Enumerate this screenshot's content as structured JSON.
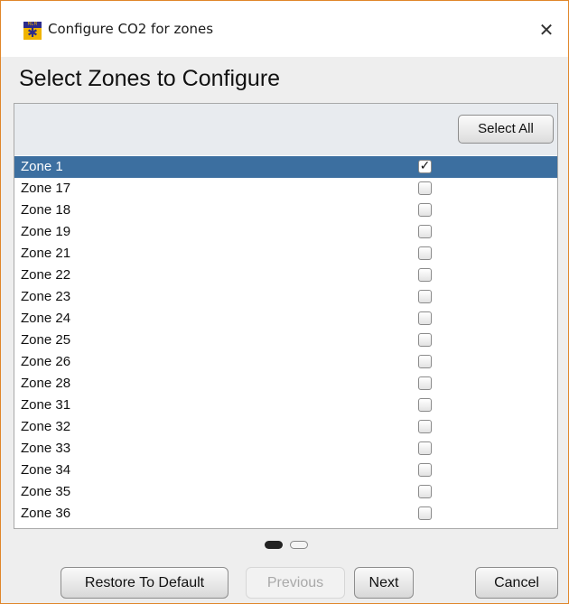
{
  "window": {
    "title": "Configure CO2 for zones",
    "close_glyph": "✕",
    "app_icon": "mlm-app-icon",
    "app_icon_text": "MLM",
    "accent_color": "#e0862a"
  },
  "page": {
    "heading": "Select Zones to Configure"
  },
  "panel": {
    "select_all_label": "Select All",
    "selected_row_color": "#3c6fa0",
    "zones": [
      {
        "label": "Zone 1",
        "checked": true,
        "selected": true
      },
      {
        "label": "Zone 17",
        "checked": false,
        "selected": false
      },
      {
        "label": "Zone 18",
        "checked": false,
        "selected": false
      },
      {
        "label": "Zone 19",
        "checked": false,
        "selected": false
      },
      {
        "label": "Zone 21",
        "checked": false,
        "selected": false
      },
      {
        "label": "Zone 22",
        "checked": false,
        "selected": false
      },
      {
        "label": "Zone 23",
        "checked": false,
        "selected": false
      },
      {
        "label": "Zone 24",
        "checked": false,
        "selected": false
      },
      {
        "label": "Zone 25",
        "checked": false,
        "selected": false
      },
      {
        "label": "Zone 26",
        "checked": false,
        "selected": false
      },
      {
        "label": "Zone 28",
        "checked": false,
        "selected": false
      },
      {
        "label": "Zone 31",
        "checked": false,
        "selected": false
      },
      {
        "label": "Zone 32",
        "checked": false,
        "selected": false
      },
      {
        "label": "Zone 33",
        "checked": false,
        "selected": false
      },
      {
        "label": "Zone 34",
        "checked": false,
        "selected": false
      },
      {
        "label": "Zone 35",
        "checked": false,
        "selected": false
      },
      {
        "label": "Zone 36",
        "checked": false,
        "selected": false
      }
    ]
  },
  "pager": {
    "current_page": 1,
    "page_count": 2
  },
  "footer": {
    "restore_label": "Restore To Default",
    "previous_label": "Previous",
    "previous_enabled": false,
    "next_label": "Next",
    "cancel_label": "Cancel"
  }
}
